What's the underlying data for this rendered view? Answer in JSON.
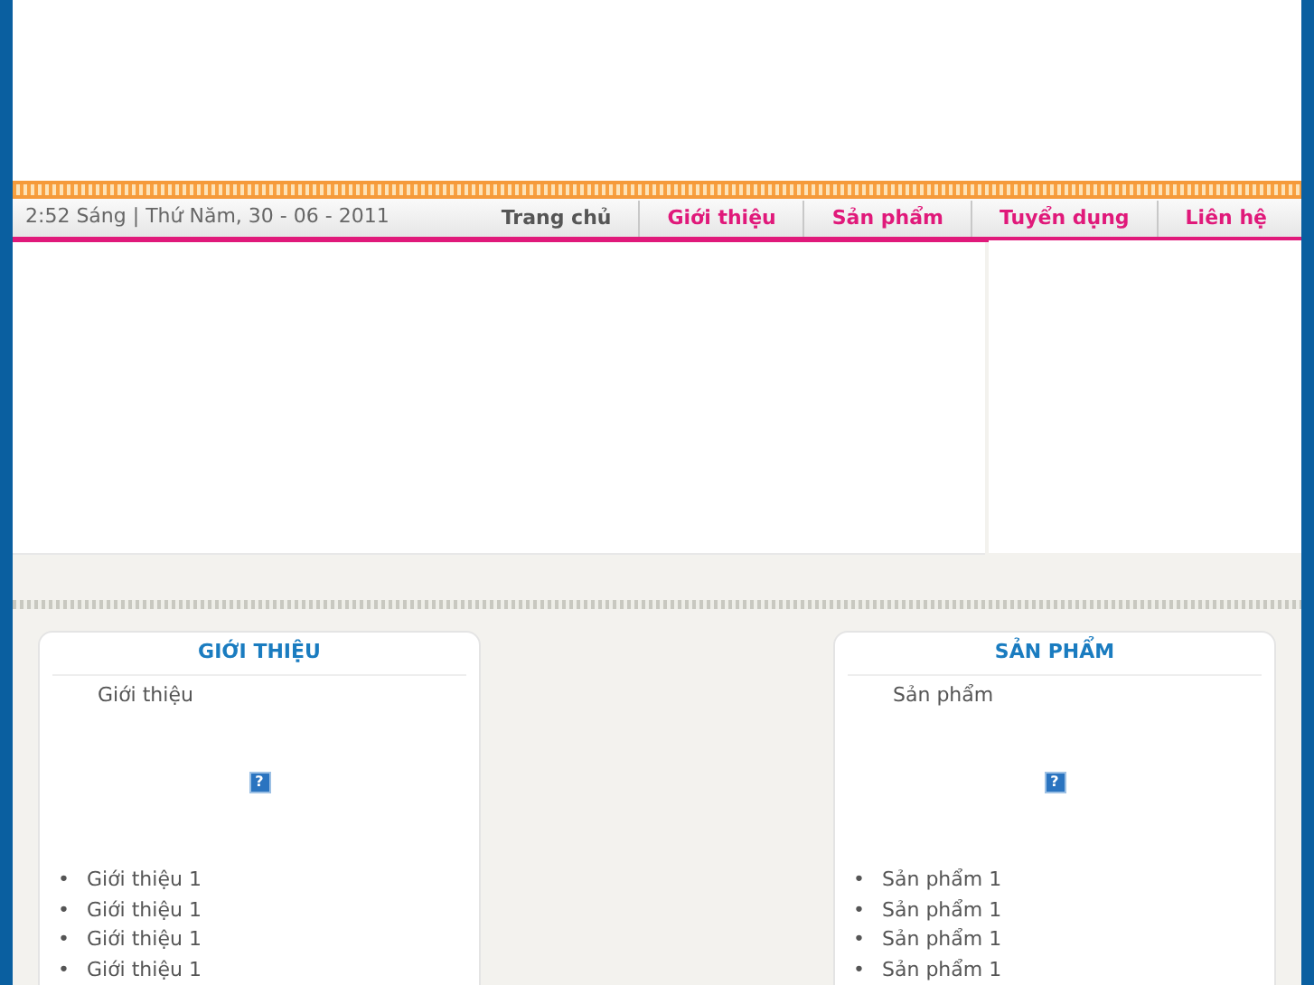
{
  "datetime": "2:52 Sáng | Thứ Năm, 30 - 06 - 2011",
  "nav": [
    {
      "label": "Trang chủ",
      "selected": true
    },
    {
      "label": "Giới thiệu",
      "selected": false
    },
    {
      "label": "Sản phẩm",
      "selected": false
    },
    {
      "label": "Tuyển dụng",
      "selected": false
    },
    {
      "label": "Liên hệ",
      "selected": false
    }
  ],
  "panels": [
    {
      "title": "GIỚI THIỆU",
      "intro": "Giới thiệu",
      "image_glyph": "?",
      "items": [
        {
          "bullet": "•",
          "text": "Giới thiệu 1"
        },
        {
          "bullet": "•",
          "text": "Giới thiệu 1"
        },
        {
          "bullet": "•",
          "text": "Giới thiệu 1"
        },
        {
          "bullet": "•",
          "text": "Giới thiệu 1"
        }
      ]
    },
    {
      "title": "SẢN PHẨM",
      "intro": "Sản phẩm",
      "image_glyph": "?",
      "items": [
        {
          "bullet": "•",
          "text": "Sản phẩm 1"
        },
        {
          "bullet": "•",
          "text": "Sản phẩm 1"
        },
        {
          "bullet": "•",
          "text": "Sản phẩm 1"
        },
        {
          "bullet": "•",
          "text": "Sản phẩm 1"
        }
      ]
    }
  ]
}
